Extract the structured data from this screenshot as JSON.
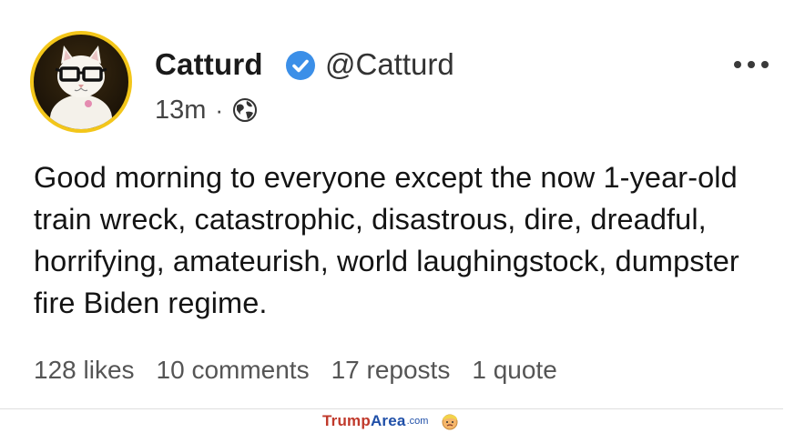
{
  "user": {
    "display_name": "Catturd",
    "handle": "@Catturd",
    "verified": true
  },
  "meta": {
    "time": "13m",
    "separator": "·",
    "visibility_icon": "globe-icon"
  },
  "post": {
    "text": "Good morning to everyone except the now 1-year-old train wreck, catastrophic, disastrous, dire, dreadful, horrifying, amateurish, world laughingstock, dumpster fire Biden regime."
  },
  "stats": {
    "likes": "128 likes",
    "comments": "10 comments",
    "reposts": "17 reposts",
    "quotes": "1 quote"
  },
  "watermark": {
    "part1": "Trump",
    "part2": "Area",
    "part3": ".com"
  },
  "colors": {
    "avatar_border": "#f3c61a",
    "verified_badge": "#3b8fe8",
    "watermark_red": "#c0392b",
    "watermark_blue": "#1f4fa8"
  }
}
